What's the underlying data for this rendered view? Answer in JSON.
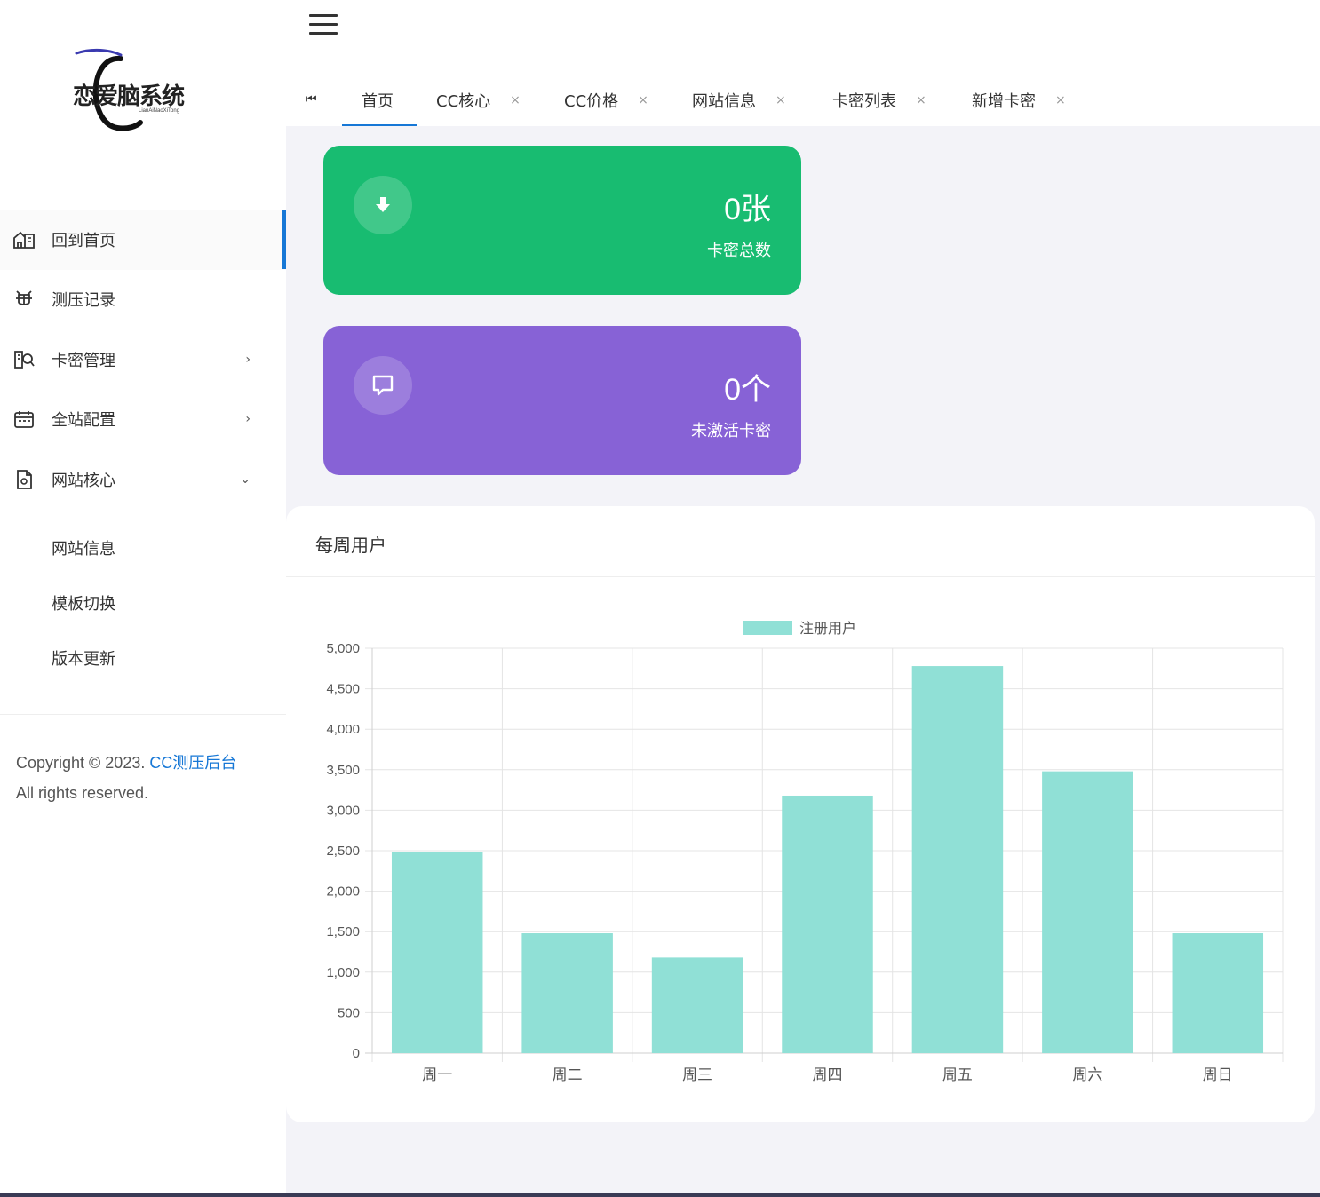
{
  "logo": {
    "text": "恋爱脑系统",
    "subtext": "LianAiNaoXiTong"
  },
  "header": {
    "tabs": [
      {
        "label": "首页",
        "closable": false,
        "active": true
      },
      {
        "label": "CC核心",
        "closable": true
      },
      {
        "label": "CC价格",
        "closable": true
      },
      {
        "label": "网站信息",
        "closable": true
      },
      {
        "label": "卡密列表",
        "closable": true
      },
      {
        "label": "新增卡密",
        "closable": true
      }
    ],
    "close_glyph": "×",
    "home_glyph": "⏮"
  },
  "sidebar": {
    "items": [
      {
        "label": "回到首页",
        "icon": "home-icon",
        "active": true
      },
      {
        "label": "测压记录",
        "icon": "bug-icon"
      },
      {
        "label": "卡密管理",
        "icon": "search-document-icon",
        "arrow": "›"
      },
      {
        "label": "全站配置",
        "icon": "calendar-icon",
        "arrow": "›"
      },
      {
        "label": "网站核心",
        "icon": "file-icon",
        "arrow": "⌄"
      }
    ],
    "sub_items": [
      "网站信息",
      "模板切换",
      "版本更新"
    ],
    "copyright_prefix": "Copyright © 2023. ",
    "copyright_link": "CC测压后台",
    "copyright_suffix": "All rights reserved."
  },
  "cards": [
    {
      "value": "0张",
      "label": "卡密总数",
      "color": "#18bc71",
      "icon": "download-arrow-icon"
    },
    {
      "value": "0个",
      "label": "未激活卡密",
      "color": "#8762d6",
      "icon": "chat-bubble-icon"
    }
  ],
  "panel": {
    "title": "每周用户"
  },
  "chart_data": {
    "type": "bar",
    "categories": [
      "周一",
      "周二",
      "周三",
      "周四",
      "周五",
      "周六",
      "周日"
    ],
    "series": [
      {
        "name": "注册用户",
        "values": [
          2480,
          1480,
          1180,
          3180,
          4780,
          3480,
          1480
        ],
        "color": "#90e0d6"
      }
    ],
    "ylim": [
      0,
      5000
    ],
    "yticks": [
      0,
      500,
      1000,
      1500,
      2000,
      2500,
      3000,
      3500,
      4000,
      4500,
      5000
    ],
    "ytick_labels": [
      "0",
      "500",
      "1,000",
      "1,500",
      "2,000",
      "2,500",
      "3,000",
      "3,500",
      "4,000",
      "4,500",
      "5,000"
    ],
    "grid": true,
    "legend": "top-center"
  }
}
